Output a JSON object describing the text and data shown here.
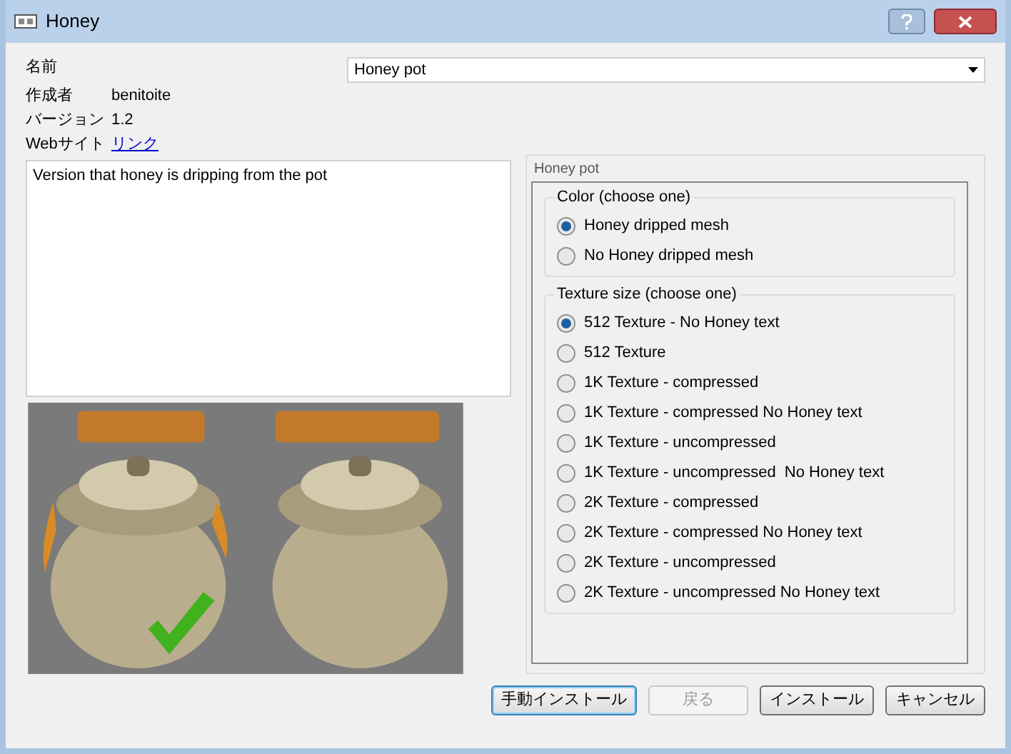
{
  "window": {
    "title": "Honey"
  },
  "name": {
    "label": "名前",
    "value": "Honey pot"
  },
  "info": [
    {
      "label": "作成者",
      "value": "benitoite",
      "kind": "text"
    },
    {
      "label": "バージョン",
      "value": "1.2",
      "kind": "text"
    },
    {
      "label": "Webサイト",
      "value": "リンク",
      "kind": "link"
    }
  ],
  "description": "Version that honey is dripping from the pot",
  "options_title": "Honey pot",
  "groups": [
    {
      "title": "Color (choose one)",
      "options": [
        {
          "label": "Honey dripped mesh",
          "selected": true
        },
        {
          "label": "No Honey dripped mesh",
          "selected": false
        }
      ]
    },
    {
      "title": "Texture size (choose one)",
      "options": [
        {
          "label": "512 Texture - No Honey text",
          "selected": true
        },
        {
          "label": "512 Texture",
          "selected": false
        },
        {
          "label": "1K Texture - compressed",
          "selected": false
        },
        {
          "label": "1K Texture - compressed No Honey text",
          "selected": false
        },
        {
          "label": "1K Texture - uncompressed",
          "selected": false
        },
        {
          "label": "1K Texture - uncompressed  No Honey text",
          "selected": false
        },
        {
          "label": "2K Texture - compressed",
          "selected": false
        },
        {
          "label": "2K Texture - compressed No Honey text",
          "selected": false
        },
        {
          "label": "2K Texture - uncompressed",
          "selected": false
        },
        {
          "label": "2K Texture - uncompressed No Honey text",
          "selected": false
        }
      ]
    }
  ],
  "buttons": [
    {
      "label": "手動インストール",
      "disabled": false,
      "focused": true
    },
    {
      "label": "戻る",
      "disabled": true,
      "focused": false
    },
    {
      "label": "インストール",
      "disabled": false,
      "focused": false
    },
    {
      "label": "キャンセル",
      "disabled": false,
      "focused": false
    }
  ]
}
